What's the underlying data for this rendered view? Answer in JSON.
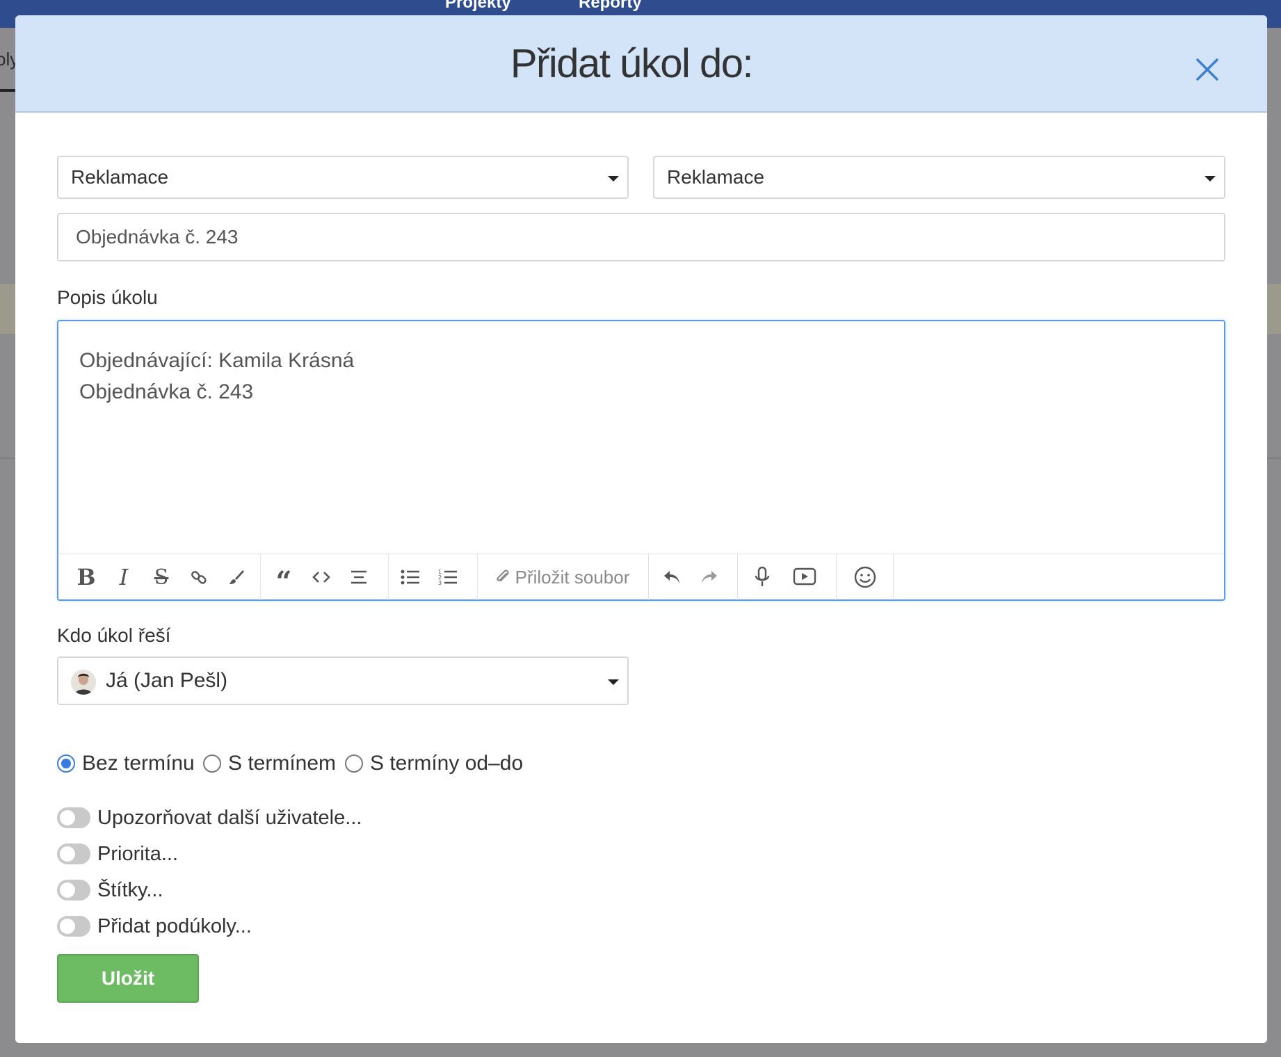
{
  "background": {
    "nav_items": [
      "Projekty",
      "Reporty"
    ],
    "tab_fragment": "oly"
  },
  "modal": {
    "title": "Přidat úkol do:",
    "close_icon": "close-icon",
    "project_select": "Reklamace",
    "list_select": "Reklamace",
    "task_name": "Objednávka č. 243",
    "description_label": "Popis úkolu",
    "description_lines": [
      "Objednávající: Kamila Krásná",
      "Objednávka č. 243"
    ],
    "toolbar": {
      "bold": "bold-icon",
      "italic": "italic-icon",
      "strikethrough": "strikethrough-icon",
      "link": "link-icon",
      "brush": "brush-icon",
      "quote": "quote-icon",
      "code": "code-icon",
      "align": "align-icon",
      "bullet_list": "bullet-list-icon",
      "numbered_list": "numbered-list-icon",
      "attach_label": "Přiložit soubor",
      "undo": "undo-icon",
      "redo": "redo-icon",
      "mic": "microphone-icon",
      "video": "video-icon",
      "emoji": "emoji-icon"
    },
    "assignee_label": "Kdo úkol řeší",
    "assignee_value": "Já (Jan Pešl)",
    "deadline_options": [
      {
        "label": "Bez termínu",
        "checked": true
      },
      {
        "label": "S termínem",
        "checked": false
      },
      {
        "label": "S termíny od–do",
        "checked": false
      }
    ],
    "toggles": [
      {
        "label": "Upozorňovat další uživatele...",
        "on": false
      },
      {
        "label": "Priorita...",
        "on": false
      },
      {
        "label": "Štítky...",
        "on": false
      },
      {
        "label": "Přidat podúkoly...",
        "on": false
      }
    ],
    "save_label": "Uložit"
  },
  "colors": {
    "header_bg": "#d3e4f8",
    "accent": "#3a7be0",
    "save_green": "#6dbb63",
    "topbar": "#2f4c8f"
  }
}
